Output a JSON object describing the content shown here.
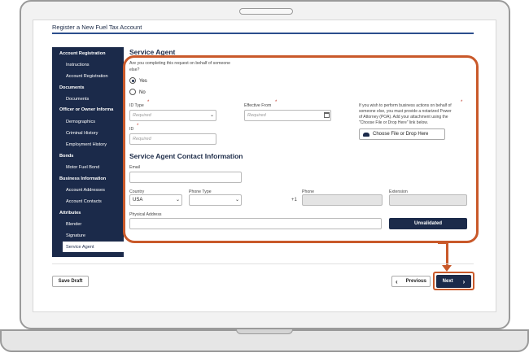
{
  "page": {
    "title": "Register a New Fuel Tax Account"
  },
  "sidebar": {
    "items": [
      {
        "label": "Account Registration",
        "type": "header"
      },
      {
        "label": "Instructions",
        "type": "item"
      },
      {
        "label": "Account Registration",
        "type": "item"
      },
      {
        "label": "Documents",
        "type": "header"
      },
      {
        "label": "Documents",
        "type": "item"
      },
      {
        "label": "Officer or Owner Informa",
        "type": "header"
      },
      {
        "label": "Demographics",
        "type": "item"
      },
      {
        "label": "Criminal History",
        "type": "item"
      },
      {
        "label": "Employment History",
        "type": "item"
      },
      {
        "label": "Bonds",
        "type": "header"
      },
      {
        "label": "Motor Fuel Bond",
        "type": "item"
      },
      {
        "label": "Business Information",
        "type": "header"
      },
      {
        "label": "Account Addresses",
        "type": "item"
      },
      {
        "label": "Account Contacts",
        "type": "item"
      },
      {
        "label": "Attributes",
        "type": "header"
      },
      {
        "label": "Blender",
        "type": "item"
      },
      {
        "label": "Signature",
        "type": "item"
      },
      {
        "label": "Service Agent",
        "type": "item",
        "active": true
      }
    ]
  },
  "form": {
    "section_title": "Service Agent",
    "question_line1": "Are you completing this request on behalf of someone",
    "question_line2": "else?",
    "radio_yes": "Yes",
    "radio_no": "No",
    "selected": "Yes",
    "id_type_label": "ID Type",
    "id_type_placeholder": "Required",
    "effective_from_label": "Effective From",
    "effective_from_placeholder": "Required",
    "id_label": "ID",
    "id_placeholder": "Required",
    "poa_line1": "If you wish to perform business actions on behalf of",
    "poa_line2": "someone else, you must provide a notarized Power",
    "poa_line3": "of Attorney (POA). Add your attachment using the",
    "poa_line4": "\"Choose File or Drop Here\" link below.",
    "choose_file_label": "Choose File or Drop Here",
    "contact_section_title": "Service Agent Contact Information",
    "email_label": "Email",
    "email_value": "",
    "country_label": "Country",
    "country_value": "USA",
    "phone_type_label": "Phone Type",
    "phone_type_value": "",
    "phone_label": "Phone",
    "phone_prefix": "+1",
    "phone_value": "",
    "extension_label": "Extension",
    "extension_value": "",
    "address_label": "Physical Address",
    "address_value": "",
    "validate_label": "Unvalidated",
    "required_mark": "*"
  },
  "footer": {
    "save_draft": "Save Draft",
    "previous": "Previous",
    "next": "Next",
    "prev_chevron": "‹",
    "next_chevron": "›"
  },
  "colors": {
    "accent": "#1b2a4a",
    "highlight": "#c9592a",
    "required": "#c0392b"
  }
}
